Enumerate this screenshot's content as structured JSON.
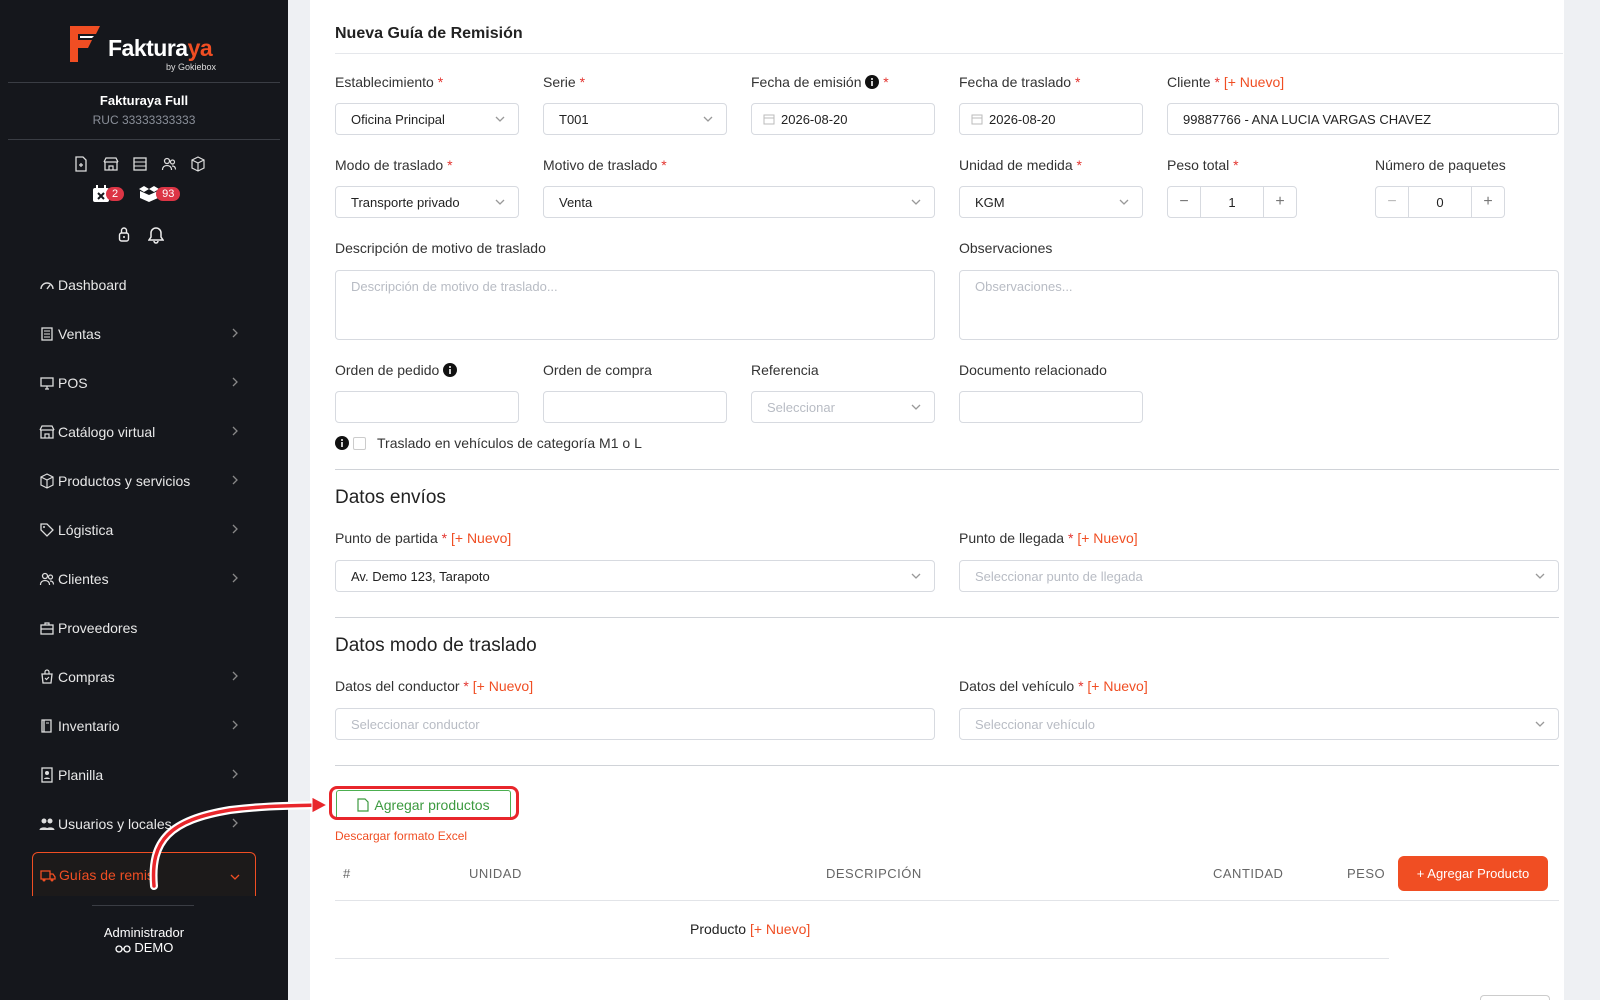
{
  "brand": {
    "name_prefix": "Faktura",
    "name_suffix": "ya",
    "tagline": "by Gokiebox"
  },
  "company": {
    "name": "Fakturaya Full",
    "ruc": "RUC 33333333333"
  },
  "badges": {
    "calendar_count": "2",
    "box_count": "93"
  },
  "sidebar": {
    "items": [
      {
        "label": "Dashboard",
        "icon": "dashboard-icon",
        "chevron": false
      },
      {
        "label": "Ventas",
        "icon": "receipt-icon",
        "chevron": true
      },
      {
        "label": "POS",
        "icon": "monitor-icon",
        "chevron": true
      },
      {
        "label": "Catálogo virtual",
        "icon": "store-icon",
        "chevron": true
      },
      {
        "label": "Productos y servicios",
        "icon": "box-icon",
        "chevron": true
      },
      {
        "label": "Lógistica",
        "icon": "tag-icon",
        "chevron": true
      },
      {
        "label": "Clientes",
        "icon": "users-icon",
        "chevron": true
      },
      {
        "label": "Proveedores",
        "icon": "briefcase-icon",
        "chevron": false
      },
      {
        "label": "Compras",
        "icon": "bag-icon",
        "chevron": true
      },
      {
        "label": "Inventario",
        "icon": "book-icon",
        "chevron": true
      },
      {
        "label": "Planilla",
        "icon": "id-card-icon",
        "chevron": true
      },
      {
        "label": "Usuarios y locales",
        "icon": "user-group-icon",
        "chevron": true
      },
      {
        "label": "Guías de remisi",
        "icon": "truck-icon",
        "chevron": true,
        "active": true
      }
    ]
  },
  "user": {
    "role": "Administrador",
    "mode": "DEMO"
  },
  "page": {
    "title": "Nueva Guía de Remisión"
  },
  "form": {
    "establecimiento": {
      "label": "Establecimiento",
      "value": "Oficina Principal"
    },
    "serie": {
      "label": "Serie",
      "value": "T001"
    },
    "fecha_emision": {
      "label": "Fecha de emisión",
      "value": "2026-08-20"
    },
    "fecha_traslado": {
      "label": "Fecha de traslado",
      "value": "2026-08-20"
    },
    "cliente": {
      "label": "Cliente",
      "nuevo": "[+ Nuevo]",
      "value": "99887766 - ANA LUCIA VARGAS CHAVEZ"
    },
    "modo_traslado": {
      "label": "Modo de traslado",
      "value": "Transporte privado"
    },
    "motivo_traslado": {
      "label": "Motivo de traslado",
      "value": "Venta"
    },
    "unidad_medida": {
      "label": "Unidad de medida",
      "value": "KGM"
    },
    "peso_total": {
      "label": "Peso total",
      "value": "1"
    },
    "num_paquetes": {
      "label": "Número de paquetes",
      "value": "0"
    },
    "descripcion_motivo": {
      "label": "Descripción de motivo de traslado",
      "placeholder": "Descripción de motivo de traslado..."
    },
    "observaciones": {
      "label": "Observaciones",
      "placeholder": "Observaciones..."
    },
    "orden_pedido": {
      "label": "Orden de pedido"
    },
    "orden_compra": {
      "label": "Orden de compra"
    },
    "referencia": {
      "label": "Referencia",
      "placeholder": "Seleccionar"
    },
    "documento_relacionado": {
      "label": "Documento relacionado"
    },
    "m1_checkbox": {
      "label": "Traslado en vehículos de categoría M1 o L",
      "checked": false
    }
  },
  "envios": {
    "title": "Datos envíos",
    "partida": {
      "label": "Punto de partida",
      "nuevo": "[+ Nuevo]",
      "value": "Av. Demo 123, Tarapoto"
    },
    "llegada": {
      "label": "Punto de llegada",
      "nuevo": "[+ Nuevo]",
      "placeholder": "Seleccionar punto de llegada"
    }
  },
  "modo": {
    "title": "Datos modo de traslado",
    "conductor": {
      "label": "Datos del conductor",
      "nuevo": "[+ Nuevo]",
      "placeholder": "Seleccionar conductor"
    },
    "vehiculo": {
      "label": "Datos del vehículo",
      "nuevo": "[+ Nuevo]",
      "placeholder": "Seleccionar vehículo"
    }
  },
  "productos": {
    "agregar_label": "Agregar productos",
    "excel_link": "Descargar formato Excel",
    "columns": [
      "#",
      "UNIDAD",
      "DESCRIPCIÓN",
      "CANTIDAD",
      "PESO"
    ],
    "add_button": "+ Agregar Producto",
    "row_label": "Producto",
    "row_nuevo": "[+ Nuevo]"
  },
  "colors": {
    "accent": "#f04e23",
    "sidebar_bg": "#15171c",
    "highlight": "#e8262b",
    "success": "#3c9a3f"
  }
}
